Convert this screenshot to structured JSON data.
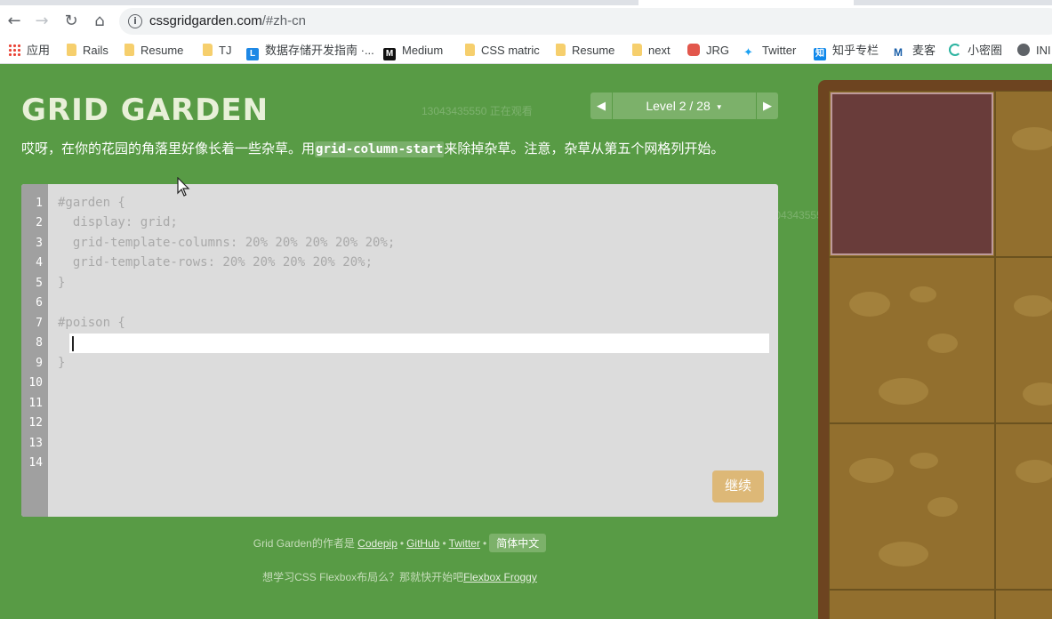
{
  "browser": {
    "url_host": "cssgridgarden.com",
    "url_path": "/#zh-cn",
    "bookmarks": [
      {
        "label": "应用",
        "icon": "apps-grid-icon"
      },
      {
        "label": "Rails",
        "icon": "folder-icon"
      },
      {
        "label": "Resume",
        "icon": "folder-icon"
      },
      {
        "label": "TJ",
        "icon": "folder-icon"
      },
      {
        "label": "数据存储开发指南 ·...",
        "icon": "l-logo-icon"
      },
      {
        "label": "Medium",
        "icon": "medium-logo-icon"
      },
      {
        "label": "CSS matric",
        "icon": "folder-icon"
      },
      {
        "label": "Resume",
        "icon": "folder-icon"
      },
      {
        "label": "next",
        "icon": "folder-icon"
      },
      {
        "label": "JRG",
        "icon": "jrg-logo-icon"
      },
      {
        "label": "Twitter",
        "icon": "twitter-bird-icon"
      },
      {
        "label": "知乎专栏",
        "icon": "zhihu-logo-icon"
      },
      {
        "label": "麦客",
        "icon": "maike-logo-icon"
      },
      {
        "label": "小密圈",
        "icon": "ring-logo-icon"
      },
      {
        "label": "INI",
        "icon": "globe-icon"
      }
    ]
  },
  "page": {
    "title": "GRID GARDEN",
    "watermark": "13043435550 正在观看",
    "level": {
      "label": "Level 2 / 28",
      "prev": "◀",
      "next": "▶",
      "caret": "▼"
    },
    "instructions": {
      "before": "哎呀，在你的花园的角落里好像长着一些杂草。用",
      "code": "grid-column-start",
      "after": "来除掉杂草。注意，杂草从第五个网格列开始。"
    },
    "editor": {
      "line_numbers": [
        "1",
        "2",
        "3",
        "4",
        "5",
        "6",
        "7",
        "8",
        "9",
        "10",
        "11",
        "12",
        "13",
        "14"
      ],
      "lines": [
        "#garden {",
        "  display: grid;",
        "  grid-template-columns: 20% 20% 20% 20% 20%;",
        "  grid-template-rows: 20% 20% 20% 20% 20%;",
        "}",
        "",
        "#poison {",
        "",
        "}"
      ],
      "input_value": "",
      "next_label": "继续"
    },
    "credits": {
      "prefix": "Grid Garden的作者是",
      "codepip": "Codepip",
      "github": "GitHub",
      "twitter": "Twitter",
      "bullet": "•",
      "language": "简体中文"
    },
    "froggy": {
      "prefix": "想学习CSS Flexbox布局么？那就快开始吧",
      "link": "Flexbox Froggy"
    }
  },
  "colors": {
    "background": "#589b45",
    "poison": "#693c3a",
    "dirt": "#926f2e",
    "next_button": "#ddb877"
  }
}
